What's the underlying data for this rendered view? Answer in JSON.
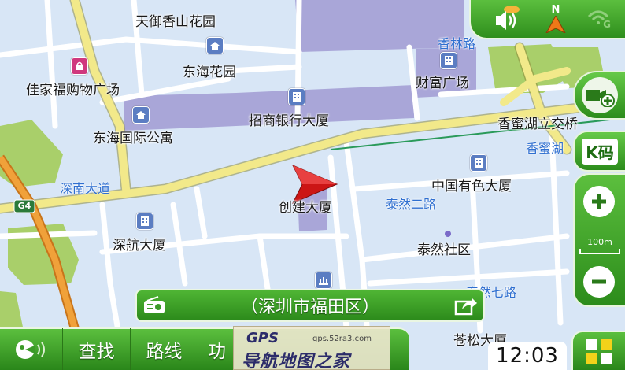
{
  "map": {
    "labels": [
      {
        "id": "tianyu",
        "text": "天御香山花园"
      },
      {
        "id": "donghai_garden",
        "text": "东海花园"
      },
      {
        "id": "jiajiafu",
        "text": "佳家福购物广场"
      },
      {
        "id": "zhaoshang",
        "text": "招商银行大厦"
      },
      {
        "id": "donghai_intl",
        "text": "东海国际公寓"
      },
      {
        "id": "caifu",
        "text": "财富广场"
      },
      {
        "id": "xiangmi_interchange",
        "text": "香蜜湖立交桥"
      },
      {
        "id": "zhongguo_yous",
        "text": "中国有色大厦"
      },
      {
        "id": "chuangjian",
        "text": "创建大厦"
      },
      {
        "id": "shenhang",
        "text": "深航大厦"
      },
      {
        "id": "tairan_community",
        "text": "泰然社区"
      },
      {
        "id": "cangsong",
        "text": "苍松大厦"
      }
    ],
    "roads": [
      {
        "id": "xianglin",
        "text": "香林路"
      },
      {
        "id": "shennan",
        "text": "深南大道"
      },
      {
        "id": "tairan2",
        "text": "泰然二路"
      },
      {
        "id": "tairan7",
        "text": "泰然七路"
      },
      {
        "id": "xiangmi",
        "text": "香蜜湖"
      }
    ],
    "highway_shield": "G4"
  },
  "status": {
    "sound_icon": "speaker-icon",
    "compass_label": "N",
    "gps_label": "G"
  },
  "controls": {
    "k_code_label": "K码",
    "scale_label": "100m"
  },
  "location_bar": {
    "district": "（深圳市福田区）"
  },
  "bottom_bar": {
    "tabs": [
      "查找",
      "路线",
      "功"
    ],
    "time": "12:03"
  },
  "watermark": {
    "logo": "GPS",
    "site": "gps.52ra3.com",
    "text": "导航地图之家"
  },
  "colors": {
    "map_bg": "#d8e6f6",
    "main_road": "#f2e98a",
    "block": "#a9a6d8",
    "green_area": "#a9cf6a",
    "ui_green": "#3fa52a",
    "highway": "#e08a22"
  }
}
